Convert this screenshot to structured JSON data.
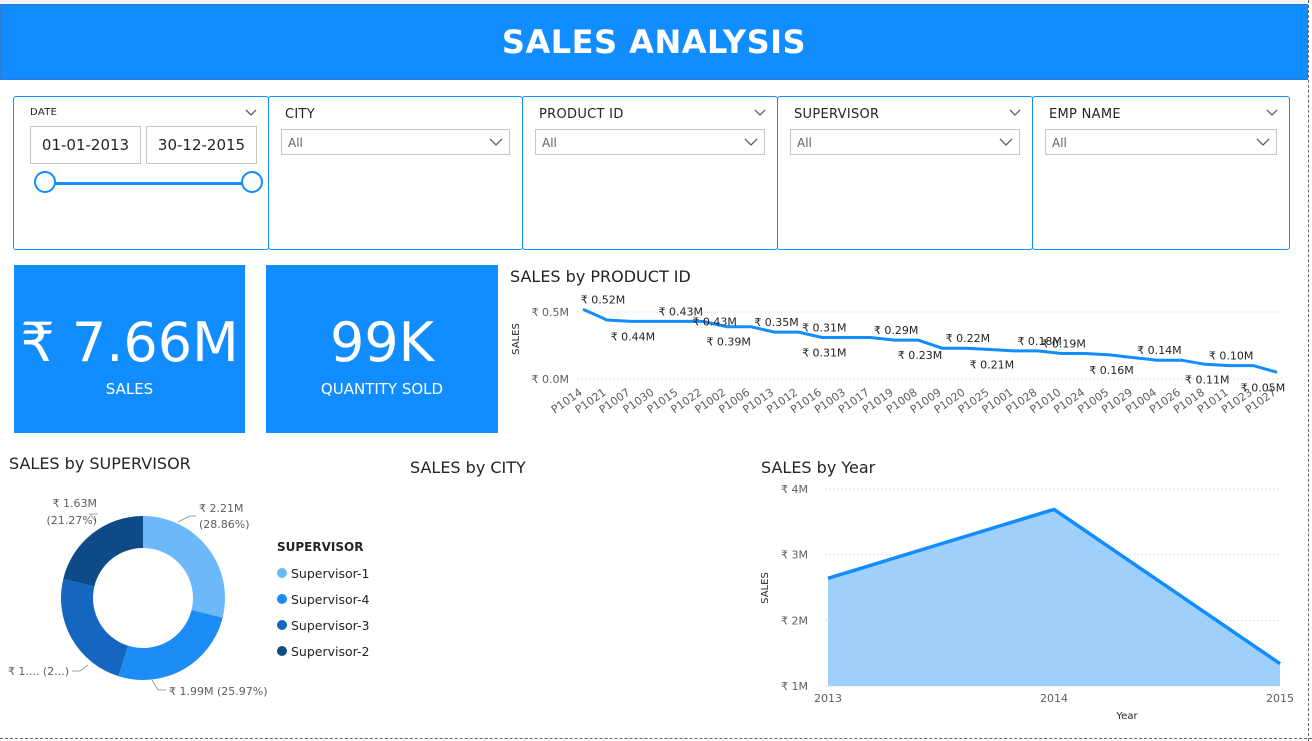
{
  "header": {
    "title": "SALES ANALYSIS"
  },
  "filters": {
    "date": {
      "label": "DATE",
      "start": "01-01-2013",
      "end": "30-12-2015"
    },
    "city": {
      "label": "CITY",
      "value": "All"
    },
    "product_id": {
      "label": "PRODUCT ID",
      "value": "All"
    },
    "supervisor": {
      "label": "SUPERVISOR",
      "value": "All"
    },
    "emp_name": {
      "label": "EMP NAME",
      "value": "All"
    }
  },
  "cards": {
    "sales": {
      "value": "₹ 7.66M",
      "label": "SALES"
    },
    "quantity": {
      "value": "99K",
      "label": "QUANTITY SOLD"
    }
  },
  "titles": {
    "product": "SALES by PRODUCT ID",
    "supervisor": "SALES by SUPERVISOR",
    "city": "SALES by CITY",
    "year": "SALES by Year"
  },
  "colors": {
    "accent": "#118dff",
    "area_fill": "#9fd0fb",
    "supervisor": [
      "#6db8f9",
      "#1e8cf5",
      "#1466c0",
      "#0d4a86"
    ]
  },
  "chart_data": [
    {
      "id": "product",
      "type": "line",
      "title": "SALES by PRODUCT ID",
      "ylabel": "SALES",
      "yticks": [
        "₹ 0.0M",
        "₹ 0.5M"
      ],
      "ylim": [
        0,
        0.55
      ],
      "categories": [
        "P1014",
        "P1021",
        "P1007",
        "P1030",
        "P1015",
        "P1022",
        "P1002",
        "P1006",
        "P1013",
        "P1012",
        "P1016",
        "P1003",
        "P1017",
        "P1019",
        "P1008",
        "P1009",
        "P1020",
        "P1025",
        "P1001",
        "P1028",
        "P1010",
        "P1024",
        "P1005",
        "P1029",
        "P1004",
        "P1026",
        "P1018",
        "P1011",
        "P1023",
        "P1027"
      ],
      "values": [
        0.52,
        0.44,
        0.43,
        0.43,
        0.43,
        0.43,
        0.39,
        0.39,
        0.35,
        0.35,
        0.31,
        0.31,
        0.31,
        0.29,
        0.29,
        0.23,
        0.23,
        0.22,
        0.21,
        0.21,
        0.19,
        0.19,
        0.18,
        0.16,
        0.14,
        0.14,
        0.11,
        0.1,
        0.1,
        0.05
      ],
      "data_labels": [
        {
          "i": 0,
          "text": "₹ 0.52M",
          "pos": "above"
        },
        {
          "i": 2,
          "text": "₹ 0.44M",
          "pos": "below"
        },
        {
          "i": 4,
          "text": "₹ 0.43M",
          "pos": "above"
        },
        {
          "i": 5,
          "text": "₹ 0.43M",
          "pos": "right"
        },
        {
          "i": 6,
          "text": "₹ 0.39M",
          "pos": "below"
        },
        {
          "i": 8,
          "text": "₹ 0.35M",
          "pos": "above"
        },
        {
          "i": 10,
          "text": "₹ 0.31M",
          "pos": "above"
        },
        {
          "i": 10,
          "text": "₹ 0.31M",
          "pos": "below"
        },
        {
          "i": 13,
          "text": "₹ 0.29M",
          "pos": "above"
        },
        {
          "i": 14,
          "text": "₹ 0.23M",
          "pos": "below"
        },
        {
          "i": 16,
          "text": "₹ 0.22M",
          "pos": "above"
        },
        {
          "i": 17,
          "text": "₹ 0.21M",
          "pos": "below"
        },
        {
          "i": 19,
          "text": "₹ 0.18M",
          "pos": "above"
        },
        {
          "i": 20,
          "text": "₹ 0.19M",
          "pos": "above"
        },
        {
          "i": 22,
          "text": "₹ 0.16M",
          "pos": "below"
        },
        {
          "i": 24,
          "text": "₹ 0.14M",
          "pos": "above"
        },
        {
          "i": 26,
          "text": "₹ 0.11M",
          "pos": "below"
        },
        {
          "i": 27,
          "text": "₹ 0.10M",
          "pos": "above"
        },
        {
          "i": 29,
          "text": "₹ 0.05M",
          "pos": "below"
        }
      ]
    },
    {
      "id": "supervisor",
      "type": "pie",
      "title": "SALES by SUPERVISOR",
      "legend_title": "SUPERVISOR",
      "slices": [
        {
          "name": "Supervisor-1",
          "value": 2.21,
          "pct": 28.86,
          "label": "₹ 2.21M",
          "label2": "(28.86%)"
        },
        {
          "name": "Supervisor-4",
          "value": 1.99,
          "pct": 25.97,
          "label": "₹ 1.99M (25.97%)",
          "label2": ""
        },
        {
          "name": "Supervisor-3",
          "value": 1.83,
          "pct": 23.9,
          "label": "₹ 1.... (2...)",
          "label2": ""
        },
        {
          "name": "Supervisor-2",
          "value": 1.63,
          "pct": 21.27,
          "label": "₹ 1.63M",
          "label2": "(21.27%)"
        }
      ]
    },
    {
      "id": "year",
      "type": "area",
      "title": "SALES by Year",
      "xlabel": "Year",
      "ylabel": "SALES",
      "x": [
        "2013",
        "2014",
        "2015"
      ],
      "values": [
        2.64,
        3.69,
        1.34
      ],
      "yticks": [
        "₹ 1M",
        "₹ 2M",
        "₹ 3M",
        "₹ 4M"
      ],
      "ylim": [
        1,
        4
      ]
    }
  ]
}
